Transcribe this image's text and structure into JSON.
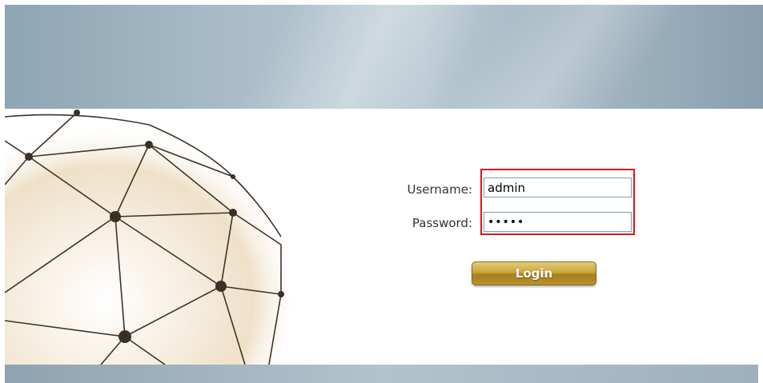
{
  "login_form": {
    "username_label": "Username:",
    "username_value": "admin",
    "password_label": "Password:",
    "password_value": "•••••",
    "login_label": "Login"
  },
  "colors": {
    "highlight_border": "#e0141c",
    "button_gold": "#c9a53a",
    "banner_blue_gray": "#a9bcc8"
  },
  "icons": {
    "globe": "geodesic-globe-graphic"
  }
}
